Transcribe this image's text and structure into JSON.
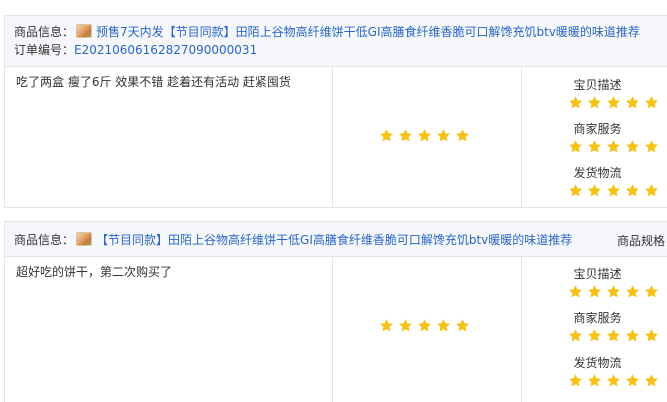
{
  "labels": {
    "product_info": "商品信息：",
    "order_no": "订单编号：",
    "spec": "商品规格",
    "desc_rating": "宝贝描述",
    "service_rating": "商家服务",
    "logistics_rating": "发货物流"
  },
  "reviews": [
    {
      "product_title": "预售7天内发【节目同款】田陌上谷物高纤维饼干低GI高膳食纤维香脆可口解馋充饥btv暖暖的味道推荐",
      "order_number": "E20210606162827090000031",
      "comment": "吃了两盒 瘦了6斤 效果不错 趁着还有活动 赶紧囤货",
      "overall_rating": 5,
      "desc_rating": 5,
      "service_rating": 5,
      "logistics_rating": 5
    },
    {
      "product_title": "【节目同款】田陌上谷物高纤维饼干低GI高膳食纤维香脆可口解馋充饥btv暖暖的味道推荐",
      "comment": "超好吃的饼干，第二次购买了",
      "overall_rating": 5,
      "desc_rating": 5,
      "service_rating": 5,
      "logistics_rating": 5
    }
  ],
  "colors": {
    "link": "#2a66c9",
    "star": "#f6c218",
    "header_bg": "#f5f7fa",
    "border": "#e5e5e5"
  },
  "icons": {
    "star": "star-icon",
    "thumbnail": "product-thumbnail"
  }
}
